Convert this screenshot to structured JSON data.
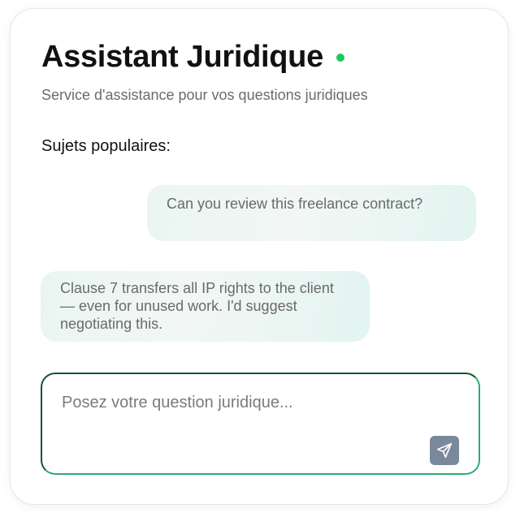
{
  "header": {
    "title": "Assistant Juridique",
    "status_color": "#22c55e",
    "subtitle": "Service d'assistance pour vos questions juridiques"
  },
  "topics": {
    "label": "Sujets populaires:"
  },
  "messages": [
    {
      "role": "user",
      "text": "Can you review this freelance contract?"
    },
    {
      "role": "assistant",
      "text": "Clause 7 transfers all IP rights to the client — even for unused work. I'd suggest negotiating this."
    }
  ],
  "composer": {
    "placeholder": "Posez votre question juridique...",
    "value": "",
    "send_icon": "paper-plane-icon",
    "send_color": "#7a889c"
  }
}
